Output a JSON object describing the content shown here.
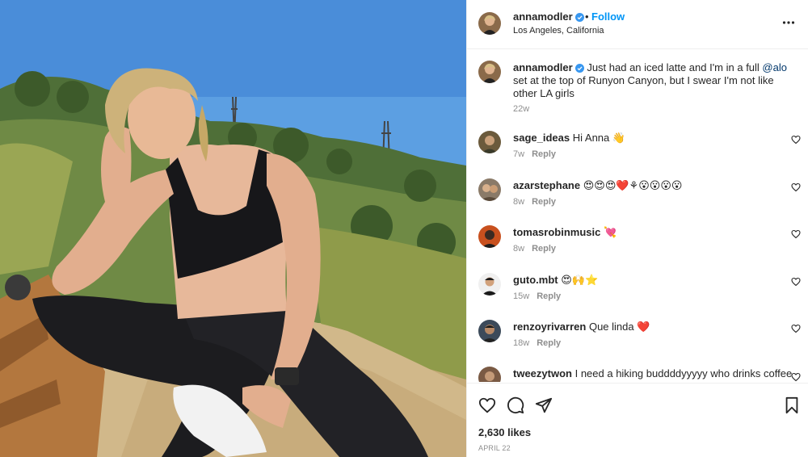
{
  "post": {
    "author": {
      "username": "annamodler",
      "verified": true,
      "location": "Los Angeles, California"
    },
    "follow_label": "Follow",
    "dot": "•",
    "caption": {
      "username": "annamodler",
      "text_before": "Just had an iced latte and I'm in a full ",
      "mention": "@alo",
      "text_after": " set at the top of Runyon Canyon, but I swear I'm not like other LA girls",
      "age": "22w"
    },
    "comments": [
      {
        "username": "sage_ideas",
        "text": "Hi Anna 👋",
        "age": "7w",
        "reply_label": "Reply",
        "avatar_color": "#6b5a3c"
      },
      {
        "username": "azarstephane",
        "text": "😍😍😍❤️⚘😮😮😮😮",
        "age": "8w",
        "reply_label": "Reply",
        "avatar_color": "#8a7a68"
      },
      {
        "username": "tomasrobinmusic",
        "text": "💘",
        "age": "8w",
        "reply_label": "Reply",
        "avatar_color": "#c8501e"
      },
      {
        "username": "guto.mbt",
        "text": "😍🙌⭐",
        "age": "15w",
        "reply_label": "Reply",
        "avatar_color": "#2a2a2a"
      },
      {
        "username": "renzoyrivarren",
        "text": "Que linda ❤️",
        "age": "18w",
        "reply_label": "Reply",
        "avatar_color": "#3c4a5a"
      },
      {
        "username": "tweezytwon",
        "text": "I need a hiking buddddyyyyy who drinks coffee",
        "age": "",
        "reply_label": "",
        "avatar_color": "#7a5a44"
      }
    ],
    "likes": "2,630 likes",
    "date": "APRIL 22",
    "icons": {
      "more": "more-options-icon",
      "like": "heart-icon",
      "comment": "comment-icon",
      "share": "paper-plane-icon",
      "save": "bookmark-icon",
      "verified": "verified-badge-icon"
    },
    "colors": {
      "link": "#0095f6",
      "mention": "#00376b",
      "muted": "#8e8e8e",
      "verified": "#3897f0"
    }
  }
}
